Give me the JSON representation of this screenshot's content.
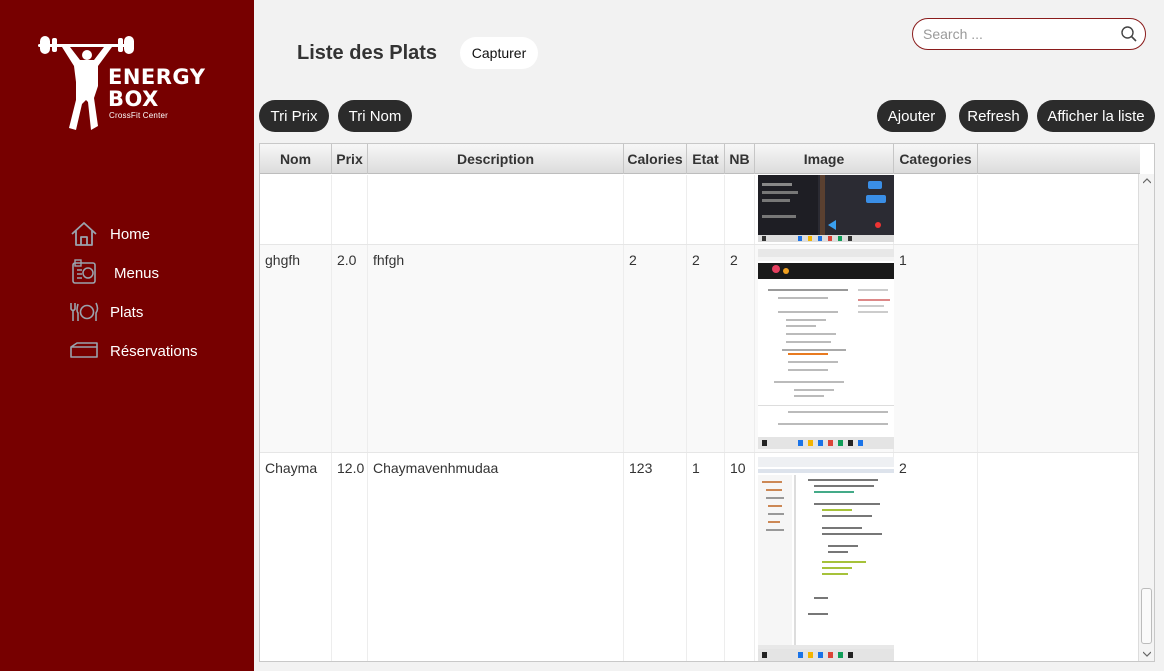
{
  "brand": {
    "line1": "ENERGY",
    "line2": "BOX",
    "subtitle": "CrossFit Center"
  },
  "sidebar": {
    "items": [
      {
        "label": "Home",
        "icon": "home-icon"
      },
      {
        "label": "Menus",
        "icon": "menu-icon"
      },
      {
        "label": "Plats",
        "icon": "dishes-icon"
      },
      {
        "label": "Réservations",
        "icon": "reservation-icon"
      }
    ]
  },
  "header": {
    "title": "Liste des Plats",
    "capture_label": "Capturer"
  },
  "search": {
    "placeholder": "Search ...",
    "icon": "search-icon"
  },
  "toolbar": {
    "sort_price": "Tri Prix",
    "sort_name": "Tri Nom",
    "add": "Ajouter",
    "refresh": "Refresh",
    "show_list": "Afficher la liste"
  },
  "table": {
    "columns": [
      "Nom",
      "Prix",
      "Description",
      "Calories",
      "Etat",
      "NB",
      "Image",
      "Categories"
    ],
    "rows": [
      {
        "nom": "",
        "prix": "",
        "description": "",
        "calories": "",
        "etat": "",
        "nb": "",
        "categories": ""
      },
      {
        "nom": "ghgfh",
        "prix": "2.0",
        "description": "fhfgh",
        "calories": "2",
        "etat": "2",
        "nb": "2",
        "categories": "1"
      },
      {
        "nom": "Chayma",
        "prix": "12.0",
        "description": "Chaymavenhmudaa",
        "calories": "123",
        "etat": "1",
        "nb": "10",
        "categories": "2"
      }
    ]
  },
  "colors": {
    "sidebar": "#770000",
    "button": "#2b2b2b",
    "search_border": "#8a1c1c"
  }
}
